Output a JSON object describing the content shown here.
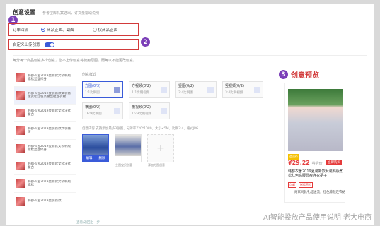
{
  "header": {
    "title": "创意设置",
    "subtitle": "参考宝库礼案选出，订货量帮助说明"
  },
  "callouts": {
    "one": "1",
    "two": "2",
    "three": "3"
  },
  "row1": {
    "label": "订单回流",
    "option_a": "商品正面、副面",
    "option_b": "仅商品正面"
  },
  "row2": {
    "label": "自定义上传创意"
  },
  "row3_text": "每分每个商品创意多个创意，您不上传创意将使用原图，而每以不能更改创意。",
  "sidebar": {
    "items": [
      {
        "text": "韩都衣舍2019夏新款女装韩版宽松显瘦修身"
      },
      {
        "text": "韩都衣舍2019夏装新款女装韩版宽松红色高腰显瘦连衣裙"
      },
      {
        "text": "韩都衣舍2019夏新款女装法式复古"
      },
      {
        "text": "韩都衣舍2019夏装新款女装韩版"
      },
      {
        "text": "韩都衣舍2019夏新款女装韩版宽松显瘦修身"
      },
      {
        "text": "韩都衣舍2019夏新款女装法式复古"
      },
      {
        "text": "韩都衣舍2019夏新款女装韩版宽松"
      },
      {
        "text": "韩都衣舍2019夏装新款"
      }
    ]
  },
  "main": {
    "format_label": "创意样式",
    "options": [
      {
        "name": "方图(0/3)",
        "req": "1:1比例图"
      },
      {
        "name": "方视频(0/2)",
        "req": "1:1比例视频"
      },
      {
        "name": "竖图(0/2)",
        "req": "3:4比例图"
      },
      {
        "name": "竖视频(0/2)",
        "req": "3:4比例视频"
      },
      {
        "name": "横图(0/2)",
        "req": "16:9比例图"
      },
      {
        "name": "横视频(0/2)",
        "req": "16:9比例视频"
      }
    ],
    "content_label": "创意内容  支持添加最多3张图，分辨率720*1080，大小<5M，比例3:4，格式JPG",
    "card1": {
      "edit": "编辑",
      "delete": "删除"
    },
    "card2_caption": "主图宝贝创意",
    "card3_caption": "添加方图创意"
  },
  "preview": {
    "title": "创意预览",
    "tag": "会员价",
    "price": "¥29.22",
    "price_small": "券后价",
    "buy": "立即购买",
    "desc": "韩都衣舍2019夏装新款女装韩版宽松红色高腰显瘦连衣裙子",
    "badges": [
      "包邮",
      "送运费险"
    ],
    "foot": "商家同款礼品送流，红色藤领连衣裙"
  },
  "bottom": "查看/返回上一步",
  "watermark": "AI智能投放产品使用说明  老大电商"
}
